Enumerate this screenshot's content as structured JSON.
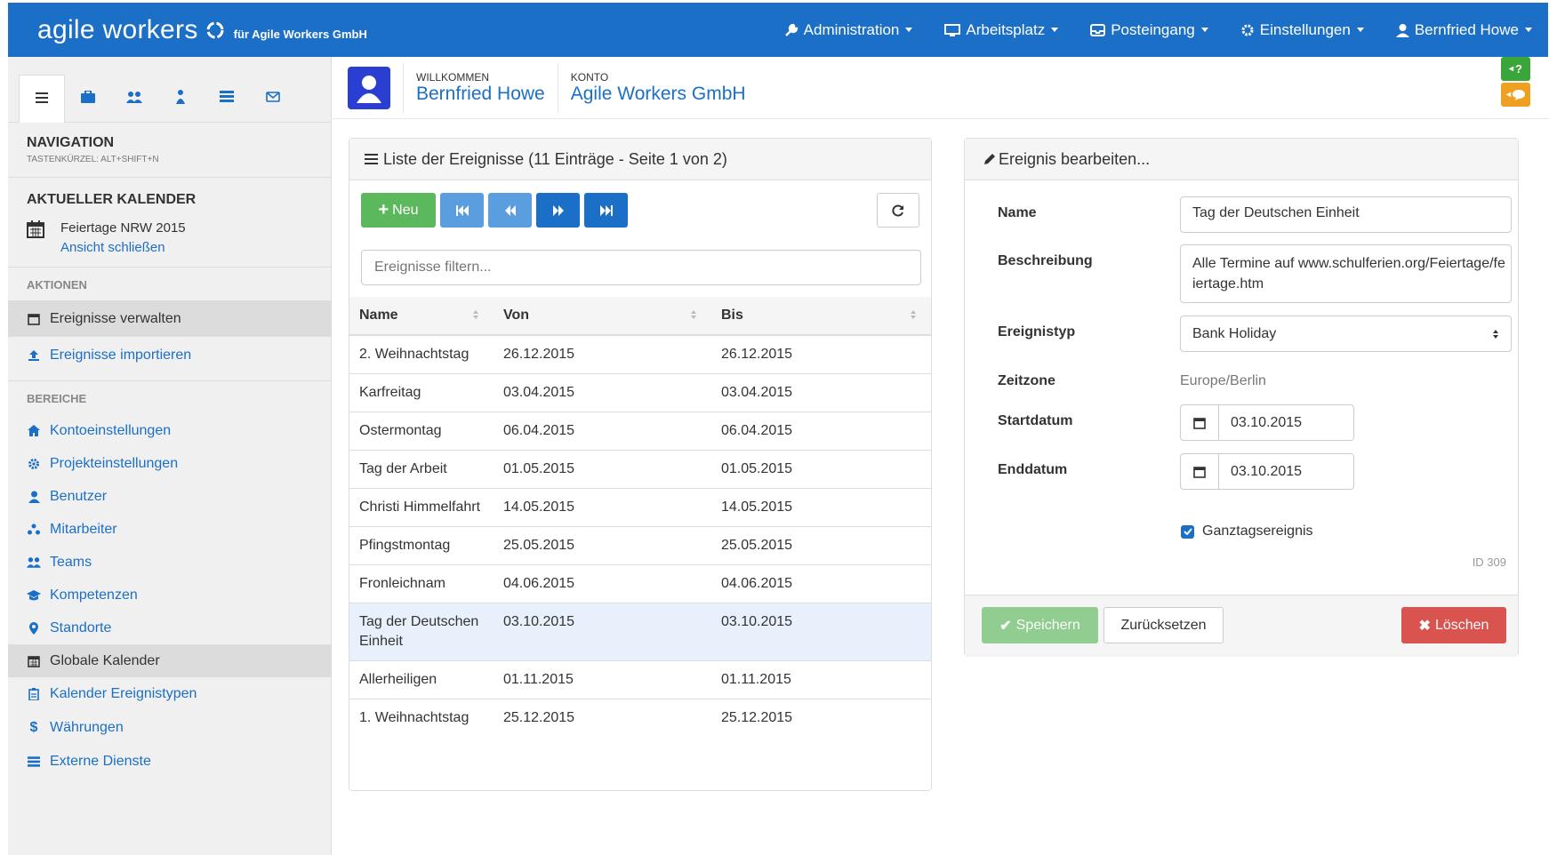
{
  "topbar": {
    "brand": "agile workers",
    "company": "für Agile Workers GmbH",
    "menu": [
      {
        "label": "Administration",
        "icon": "wrench-icon"
      },
      {
        "label": "Arbeitsplatz",
        "icon": "monitor-icon"
      },
      {
        "label": "Posteingang",
        "icon": "inbox-icon"
      },
      {
        "label": "Einstellungen",
        "icon": "gear-icon"
      },
      {
        "label": "Bernfried Howe",
        "icon": "user-icon"
      }
    ]
  },
  "sidebar": {
    "nav_title": "NAVIGATION",
    "nav_shortcut": "TASTENKÜRZEL: ALT+SHIFT+N",
    "calendar_title": "AKTUELLER KALENDER",
    "calendar_name": "Feiertage NRW 2015",
    "calendar_close": "Ansicht schließen",
    "actions_label": "AKTIONEN",
    "actions": [
      "Ereignisse verwalten",
      "Ereignisse importieren"
    ],
    "areas_label": "BEREICHE",
    "areas": [
      "Kontoeinstellungen",
      "Projekteinstellungen",
      "Benutzer",
      "Mitarbeiter",
      "Teams",
      "Kompetenzen",
      "Standorte",
      "Globale Kalender",
      "Kalender Ereignistypen",
      "Währungen",
      "Externe Dienste"
    ]
  },
  "header": {
    "welcome_label": "WILLKOMMEN",
    "user_name": "Bernfried Howe",
    "account_label": "KONTO",
    "account_name": "Agile Workers GmbH",
    "help_badge": "?"
  },
  "list": {
    "title": "Liste der Ereignisse (11 Einträge - Seite 1 von 2)",
    "new_label": "Neu",
    "filter_placeholder": "Ereignisse filtern...",
    "columns": [
      "Name",
      "Von",
      "Bis"
    ],
    "rows": [
      {
        "name": "2. Weihnachtstag",
        "from": "26.12.2015",
        "to": "26.12.2015"
      },
      {
        "name": "Karfreitag",
        "from": "03.04.2015",
        "to": "03.04.2015"
      },
      {
        "name": "Ostermontag",
        "from": "06.04.2015",
        "to": "06.04.2015"
      },
      {
        "name": "Tag der Arbeit",
        "from": "01.05.2015",
        "to": "01.05.2015"
      },
      {
        "name": "Christi Himmelfahrt",
        "from": "14.05.2015",
        "to": "14.05.2015"
      },
      {
        "name": "Pfingstmontag",
        "from": "25.05.2015",
        "to": "25.05.2015"
      },
      {
        "name": "Fronleichnam",
        "from": "04.06.2015",
        "to": "04.06.2015"
      },
      {
        "name": "Tag der Deutschen Einheit",
        "from": "03.10.2015",
        "to": "03.10.2015"
      },
      {
        "name": "Allerheiligen",
        "from": "01.11.2015",
        "to": "01.11.2015"
      },
      {
        "name": "1. Weihnachtstag",
        "from": "25.12.2015",
        "to": "25.12.2015"
      }
    ]
  },
  "editor": {
    "title": "Ereignis bearbeiten...",
    "name_label": "Name",
    "name_value": "Tag der Deutschen Einheit",
    "desc_label": "Beschreibung",
    "desc_value": "Alle Termine auf www.schulferien.org/Feiertage/feiertage.htm",
    "type_label": "Ereignistyp",
    "type_value": "Bank Holiday",
    "tz_label": "Zeitzone",
    "tz_value": "Europe/Berlin",
    "start_label": "Startdatum",
    "start_value": "03.10.2015",
    "end_label": "Enddatum",
    "end_value": "03.10.2015",
    "allday_label": "Ganztagsereignis",
    "allday_checked": true,
    "id_text": "ID 309",
    "save_label": "Speichern",
    "reset_label": "Zurücksetzen",
    "delete_label": "Löschen"
  },
  "colors": {
    "primary": "#1b6fc7",
    "success": "#5cb85c",
    "danger": "#d9534f",
    "help": "#3aa63a",
    "feedback": "#f0a020"
  }
}
